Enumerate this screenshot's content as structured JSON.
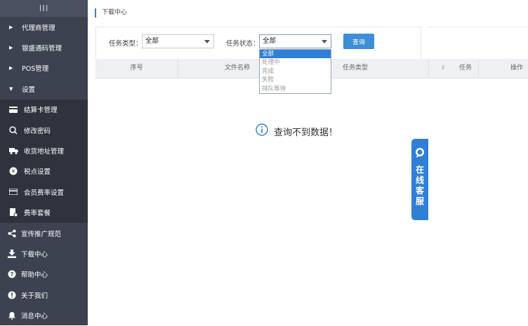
{
  "sidebar": {
    "collapse_glyph": "III",
    "items": [
      {
        "label": "代理商管理",
        "type": "group",
        "icon": "caret-right-icon"
      },
      {
        "label": "银盛通码管理",
        "type": "group",
        "icon": "caret-right-icon"
      },
      {
        "label": "POS管理",
        "type": "group",
        "icon": "caret-right-icon"
      },
      {
        "label": "设置",
        "type": "group-open",
        "icon": "caret-down-icon"
      },
      {
        "label": "结算卡管理",
        "type": "sub",
        "icon": "card-icon"
      },
      {
        "label": "修改密码",
        "type": "sub",
        "icon": "key-icon"
      },
      {
        "label": "收货地址管理",
        "type": "sub",
        "icon": "truck-icon"
      },
      {
        "label": "税点设置",
        "type": "sub",
        "icon": "tax-icon"
      },
      {
        "label": "会员费率设置",
        "type": "sub",
        "icon": "rate-card-icon"
      },
      {
        "label": "费率套餐",
        "type": "sub",
        "icon": "package-icon"
      },
      {
        "label": "宣传推广规范",
        "type": "top",
        "icon": "share-icon"
      },
      {
        "label": "下载中心",
        "type": "top",
        "icon": "download-icon"
      },
      {
        "label": "帮助中心",
        "type": "top",
        "icon": "help-icon"
      },
      {
        "label": "关于我们",
        "type": "top",
        "icon": "info-icon"
      },
      {
        "label": "消息中心",
        "type": "top",
        "icon": "bell-icon"
      }
    ]
  },
  "breadcrumb": "下载中心",
  "filters": {
    "task_type_label": "任务类型：",
    "task_type_value": "全部",
    "task_status_label": "任务状态：",
    "task_status_value": "全部",
    "query_button": "查询"
  },
  "status_dropdown": {
    "options": [
      "全部",
      "处理中",
      "完成",
      "失败",
      "排队等待"
    ],
    "selected_index": 0
  },
  "table": {
    "columns": [
      "序号",
      "文件名称",
      "任务类型",
      "‡",
      "任务",
      "操作"
    ]
  },
  "empty_message": "查询不到数据！",
  "service_widget": {
    "label": "在线客服"
  },
  "colors": {
    "sidebar": "#3d4250",
    "sidebar_sub": "#2f333e",
    "accent": "#2f7fd6",
    "button": "#3c8fd7"
  }
}
